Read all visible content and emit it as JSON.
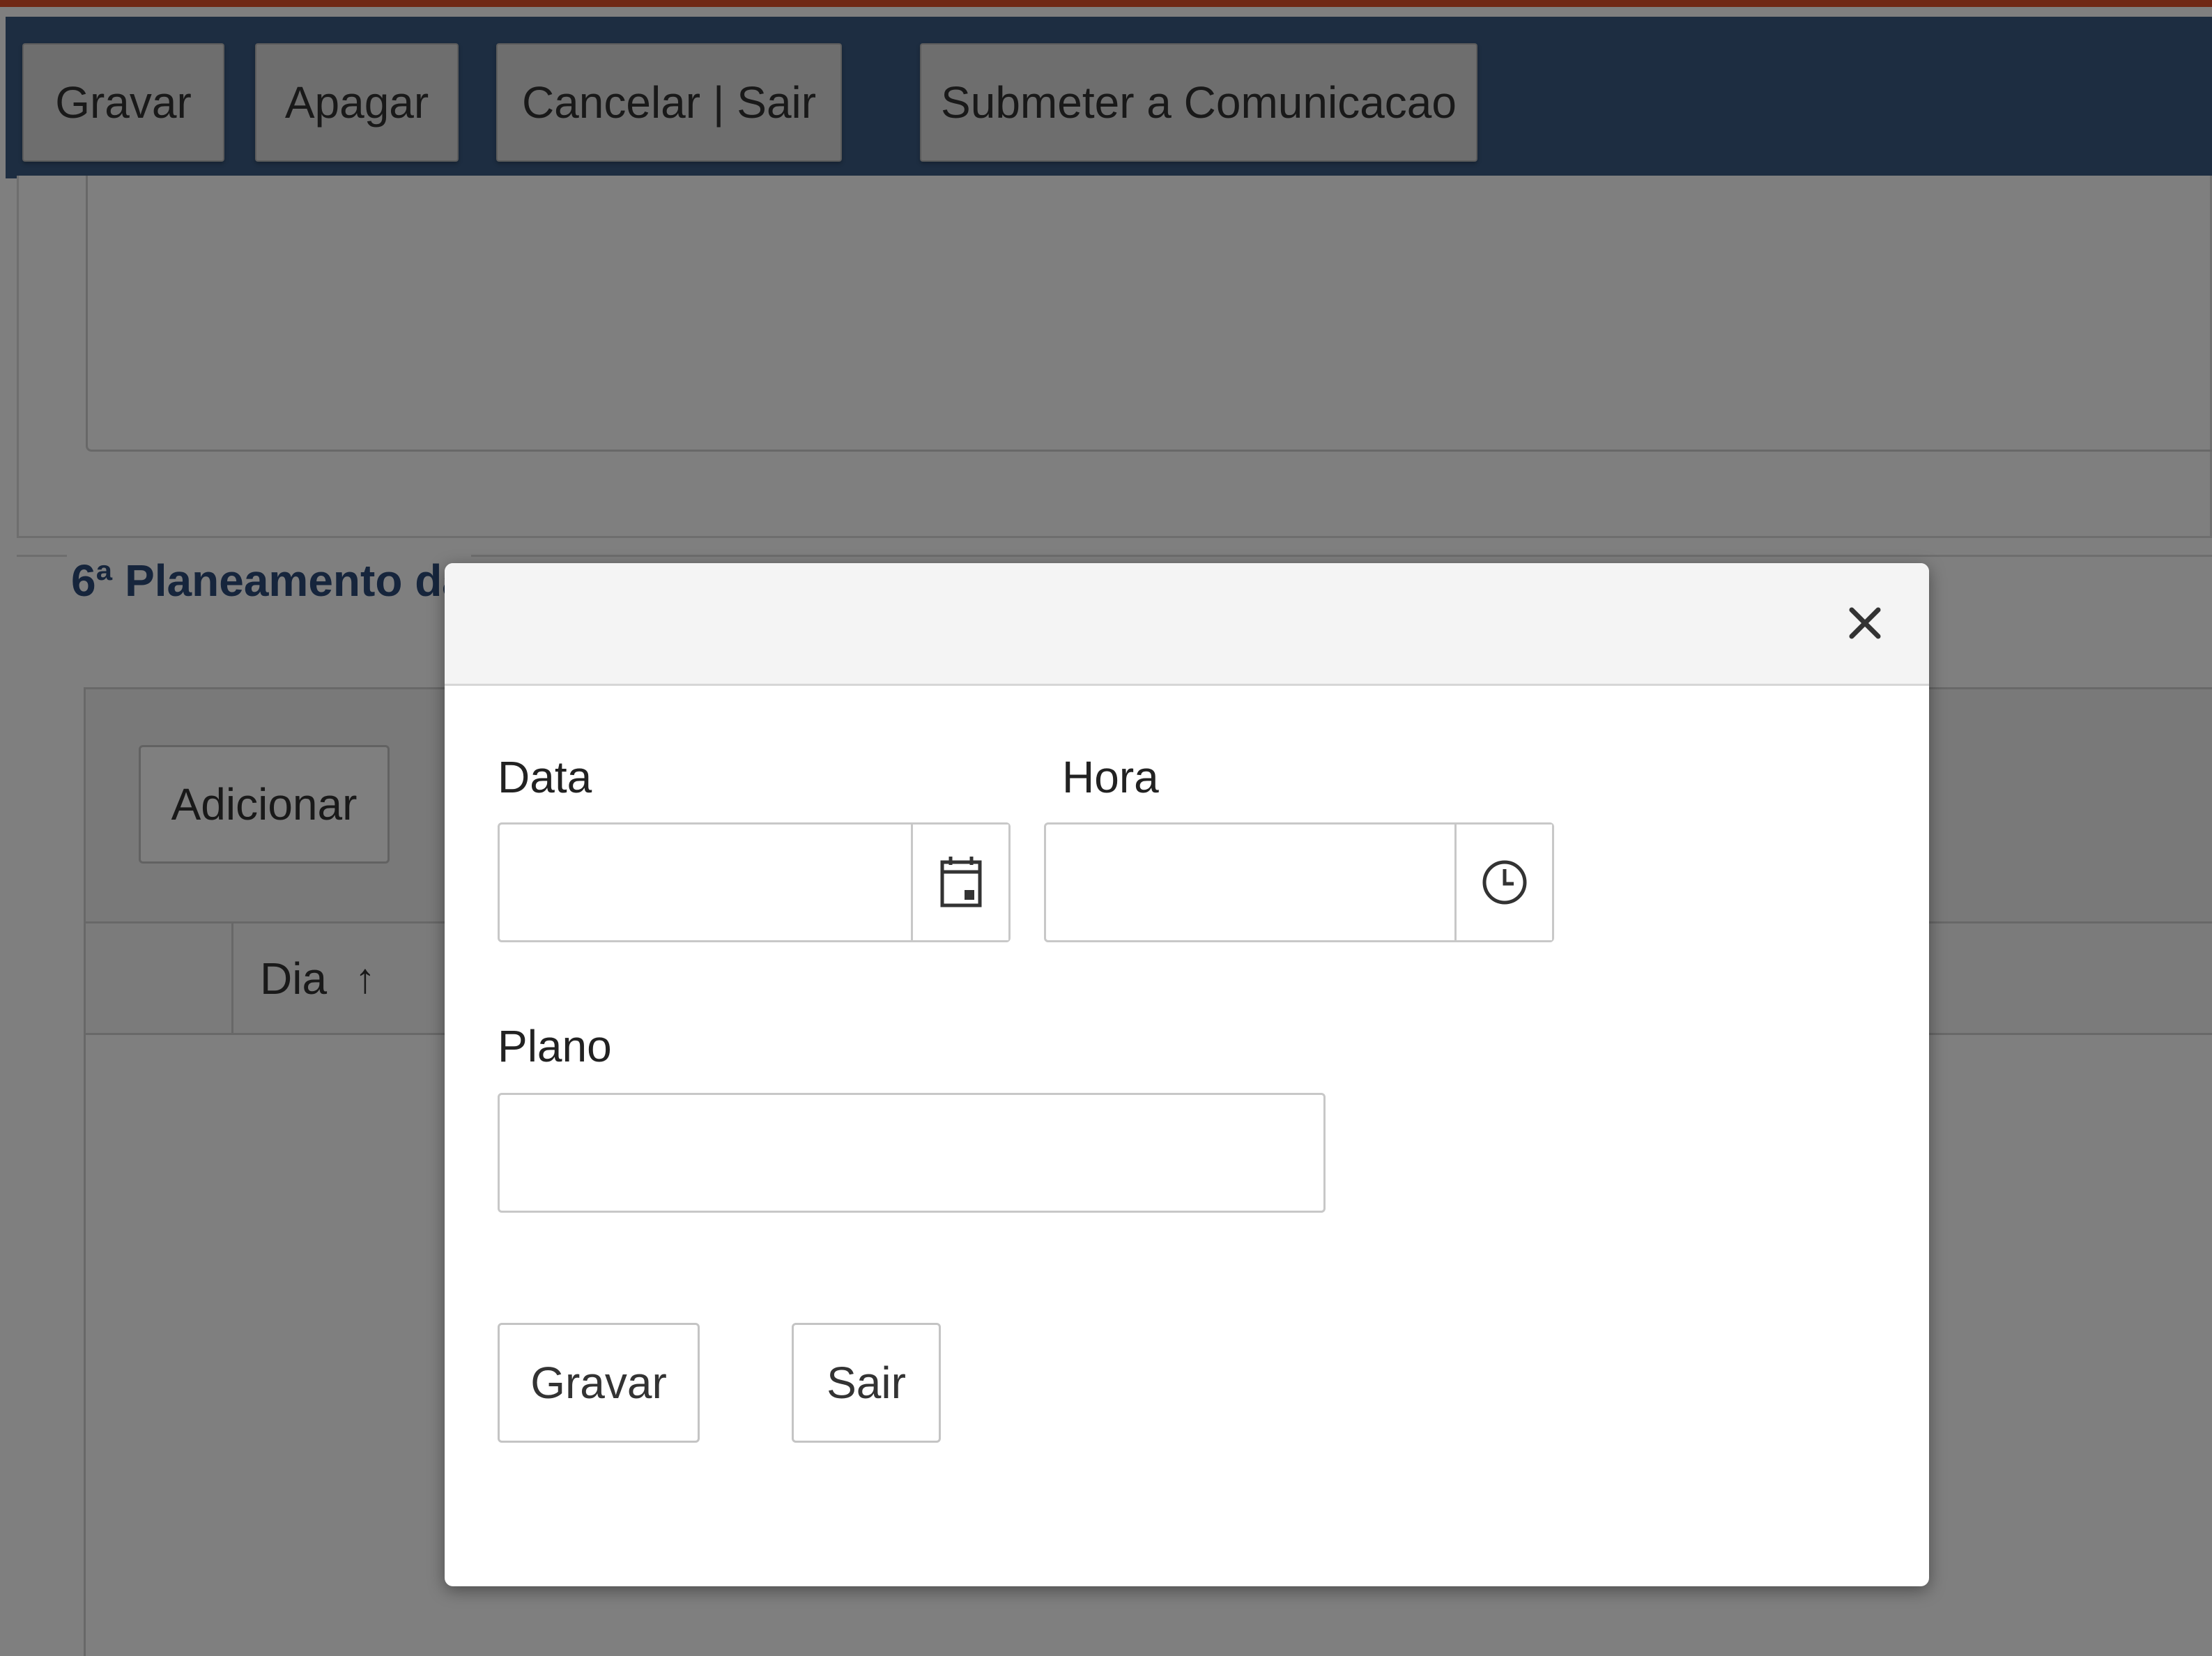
{
  "toolbar": {
    "save_label": "Gravar",
    "delete_label": "Apagar",
    "cancel_exit_label": "Cancelar | Sair",
    "submit_label": "Submeter a Comunicacao"
  },
  "section": {
    "title": "6ª Planeamento da"
  },
  "grid": {
    "add_label": "Adicionar",
    "columns": [
      "Dia"
    ],
    "sort_indicator": "↑"
  },
  "modal": {
    "close_glyph": "✕",
    "date_label": "Data",
    "date_value": "",
    "time_label": "Hora",
    "time_value": "",
    "plan_label": "Plano",
    "plan_value": "",
    "save_label": "Gravar",
    "exit_label": "Sair"
  },
  "icons": {
    "date": "calendar-icon",
    "time": "clock-icon",
    "close": "close-icon",
    "sort": "arrow-up-icon"
  },
  "colors": {
    "accent": "#e0502a",
    "toolbar_bg": "#3a5a82",
    "section_title": "#2c4a78"
  }
}
